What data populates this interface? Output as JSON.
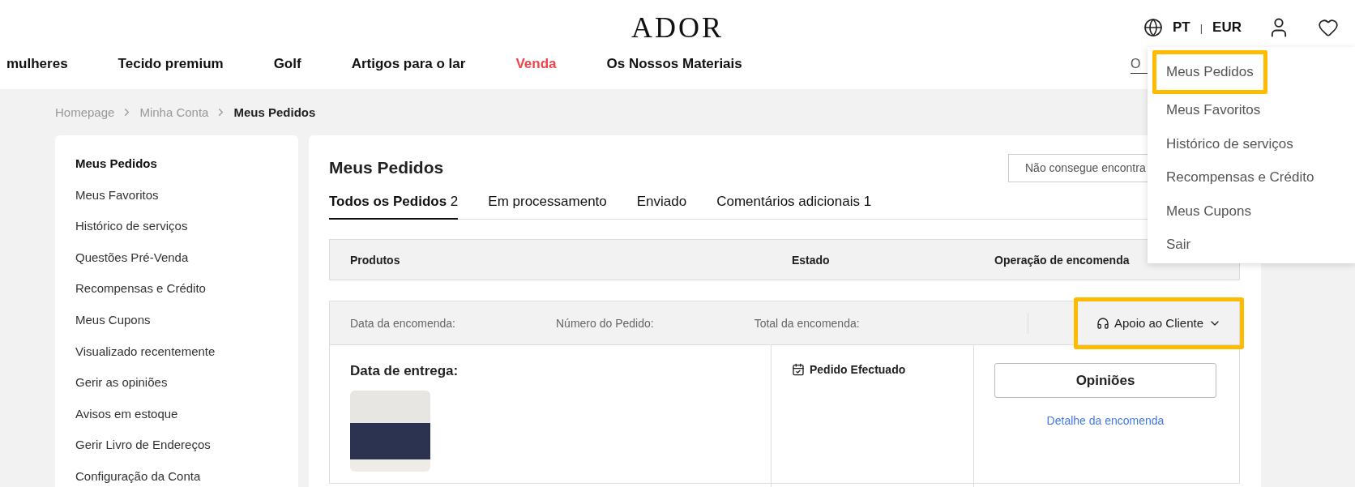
{
  "header": {
    "logo": "ADOR",
    "language": "PT",
    "separator": "|",
    "currency": "EUR",
    "search": {
      "placeholder": "O"
    }
  },
  "nav": [
    {
      "label": "mulheres",
      "color": "#111111"
    },
    {
      "label": "Tecido premium",
      "color": "#111111"
    },
    {
      "label": "Golf",
      "color": "#111111"
    },
    {
      "label": "Artigos para o lar",
      "color": "#111111"
    },
    {
      "label": "Venda",
      "color": "#f0444a"
    },
    {
      "label": "Os Nossos Materiais",
      "color": "#111111"
    }
  ],
  "breadcrumb": [
    {
      "label": "Homepage",
      "current": false
    },
    {
      "label": "Minha Conta",
      "current": false
    },
    {
      "label": "Meus Pedidos",
      "current": true
    }
  ],
  "sidebar": {
    "items": [
      {
        "label": "Meus Pedidos",
        "selected": true
      },
      {
        "label": "Meus Favoritos",
        "selected": false
      },
      {
        "label": "Histórico de serviços",
        "selected": false
      },
      {
        "label": "Questões Pré-Venda",
        "selected": false
      },
      {
        "label": "Recompensas e Crédito",
        "selected": false
      },
      {
        "label": "Meus Cupons",
        "selected": false
      },
      {
        "label": "Visualizado recentemente",
        "selected": false
      },
      {
        "label": "Gerir as opiniões",
        "selected": false
      },
      {
        "label": "Avisos em estoque",
        "selected": false
      },
      {
        "label": "Gerir Livro de Endereços",
        "selected": false
      },
      {
        "label": "Configuração da Conta",
        "selected": false
      }
    ]
  },
  "main": {
    "title": "Meus Pedidos",
    "search": {
      "placeholder": "Não consegue encontra"
    },
    "tabs": [
      {
        "label": "Todos os Pedidos",
        "count": "2",
        "selected": true
      },
      {
        "label": "Em processamento",
        "selected": false
      },
      {
        "label": "Enviado",
        "selected": false
      },
      {
        "label": "Comentários adicionais",
        "count": "1",
        "selected": false
      }
    ],
    "table": {
      "columns": [
        "Produtos",
        "Estado",
        "Operação de encomenda"
      ]
    },
    "order": {
      "fields": [
        "Data da encomenda:",
        "Número do Pedido:",
        "Total da encomenda:"
      ],
      "support": {
        "label": "Apoio ao Cliente",
        "highlighted": true
      },
      "delivery_label": "Data de entrega:",
      "status": "Pedido Efectuado",
      "review_button": "Opiniões",
      "detail_link": "Detalhe da encomenda"
    }
  },
  "account_menu": {
    "items": [
      {
        "label": "Meus Pedidos",
        "highlighted": true
      },
      {
        "label": "Meus Favoritos",
        "highlighted": false
      },
      {
        "label": "Histórico de serviços",
        "highlighted": false
      },
      {
        "label": "Recompensas e Crédito",
        "highlighted": false
      },
      {
        "label": "Meus Cupons",
        "highlighted": false
      },
      {
        "label": "Sair",
        "highlighted": false
      }
    ]
  }
}
